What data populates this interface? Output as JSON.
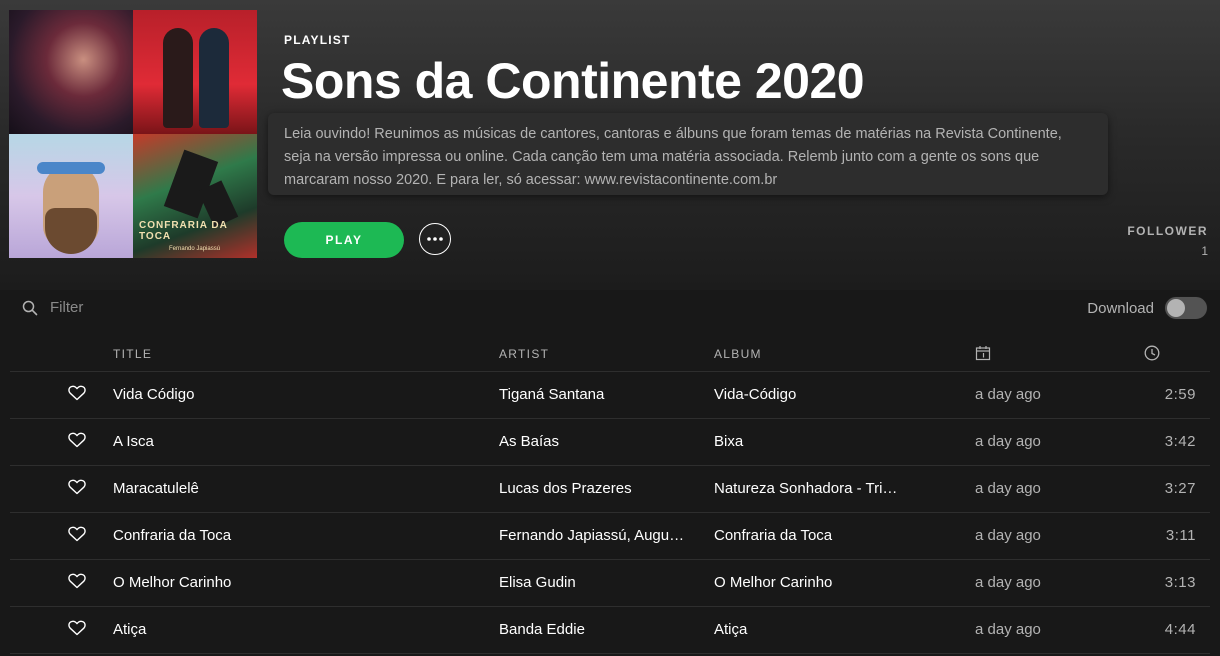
{
  "playlist": {
    "type_label": "PLAYLIST",
    "title": "Sons da Continente 2020",
    "description": "Leia ouvindo! Reunimos as músicas de cantores, cantoras e álbuns que foram temas de matérias na Revista Continente, seja na versão impressa ou online. Cada canção tem uma matéria associada. Relemb junto com a gente os sons que marcaram nosso 2020. E para ler, só acessar: www.revistacontinente.com.br",
    "cover_tile4_caption": "CONFRARIA DA TOCA",
    "cover_tile4_sub": "Fernando Japiassú"
  },
  "actions": {
    "play_label": "PLAY",
    "more_icon": "ellipsis-icon"
  },
  "followers": {
    "label": "FOLLOWER",
    "count": "1"
  },
  "toolbar": {
    "filter_placeholder": "Filter",
    "download_label": "Download",
    "download_enabled": false
  },
  "table": {
    "headers": {
      "title": "TITLE",
      "artist": "ARTIST",
      "album": "ALBUM",
      "added_icon": "calendar-icon",
      "duration_icon": "clock-icon"
    },
    "rows": [
      {
        "title": "Vida Código",
        "artist": "Tiganá Santana",
        "album": "Vida-Código",
        "added": "a day ago",
        "duration": "2:59"
      },
      {
        "title": "A Isca",
        "artist": "As Baías",
        "album": "Bixa",
        "added": "a day ago",
        "duration": "3:42"
      },
      {
        "title": "Maracatulelê",
        "artist": "Lucas dos Prazeres",
        "album": "Natureza Sonhadora - Tri…",
        "added": "a day ago",
        "duration": "3:27"
      },
      {
        "title": "Confraria da Toca",
        "artist": "Fernando Japiassú, Augu…",
        "album": "Confraria da Toca",
        "added": "a day ago",
        "duration": "3:11"
      },
      {
        "title": "O Melhor Carinho",
        "artist": "Elisa Gudin",
        "album": "O Melhor Carinho",
        "added": "a day ago",
        "duration": "3:13"
      },
      {
        "title": "Atiça",
        "artist": "Banda Eddie",
        "album": "Atiça",
        "added": "a day ago",
        "duration": "4:44"
      }
    ]
  },
  "colors": {
    "accent": "#1db954",
    "background": "#181818",
    "text_secondary": "#b3b3b3"
  }
}
